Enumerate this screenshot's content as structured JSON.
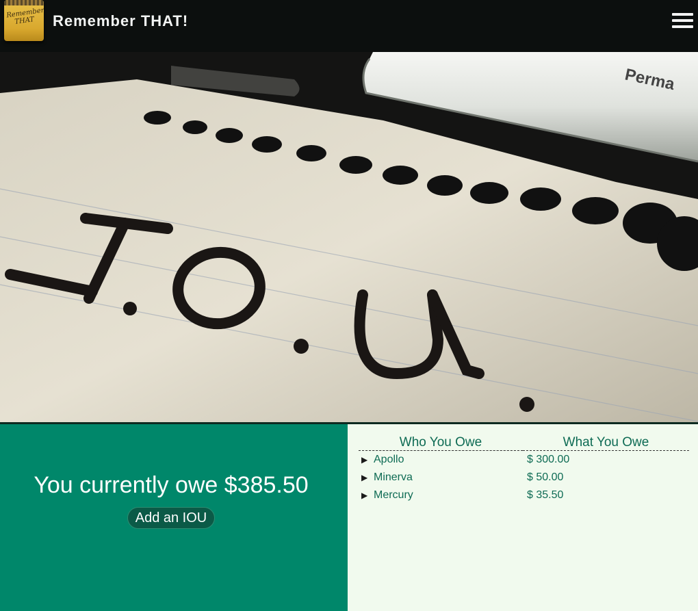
{
  "header": {
    "logo_text": "Remember!! THAT",
    "title": "Remember THAT!",
    "menu_icon": "hamburger-menu-icon"
  },
  "hero": {
    "image_text": "I.O.U.",
    "marker_text": "Perma"
  },
  "summary": {
    "owe_text": "You currently owe $385.50",
    "add_button_label": "Add an IOU"
  },
  "table": {
    "headers": [
      "Who You Owe",
      "What You Owe"
    ],
    "rows": [
      {
        "name": "Apollo",
        "amount": "$ 300.00"
      },
      {
        "name": "Minerva",
        "amount": "$ 50.00"
      },
      {
        "name": "Mercury",
        "amount": "$ 35.50"
      }
    ]
  },
  "colors": {
    "header_bg": "#0c0f0e",
    "left_panel": "#00876a",
    "right_panel": "#f1faee",
    "text_green": "#0e6b54",
    "button_bg": "#0b5a47"
  }
}
